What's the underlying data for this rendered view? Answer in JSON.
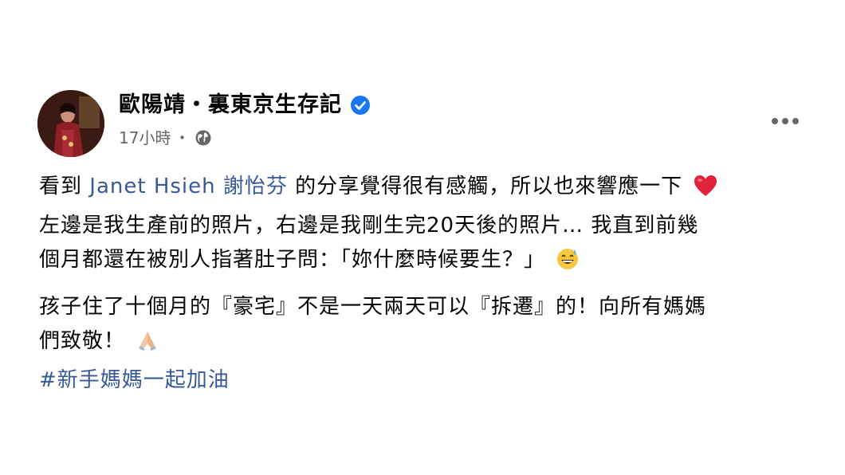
{
  "post": {
    "author": "歐陽靖・裏東京生存記",
    "timestamp": "17小時",
    "meta_separator": "・",
    "privacy_icon": "globe-icon",
    "verified_icon": "verified-badge-icon",
    "more_icon": "more-options-icon",
    "verified_color": "#1877f2",
    "link_color": "#385898",
    "body": {
      "line1_prefix": "看到",
      "mention": "Janet Hsieh 謝怡芬",
      "line1_suffix": "的分享覺得很有感觸，所以也來響應一下",
      "line1_emoji": "red-heart-emoji",
      "line2": "左邊是我生產前的照片，右邊是我剛生完20天後的照片… 我直到前幾",
      "line3": "個月都還在被別人指著肚子問：「妳什麼時候要生？」",
      "line3_emoji": "grinning-sweat-emoji",
      "line4": "孩子住了十個月的『豪宅』不是一天兩天可以『拆遷』的！向所有媽媽",
      "line5": "們致敬！",
      "line5_emoji": "folded-hands-emoji",
      "hashtag": "#新手媽媽一起加油"
    }
  }
}
